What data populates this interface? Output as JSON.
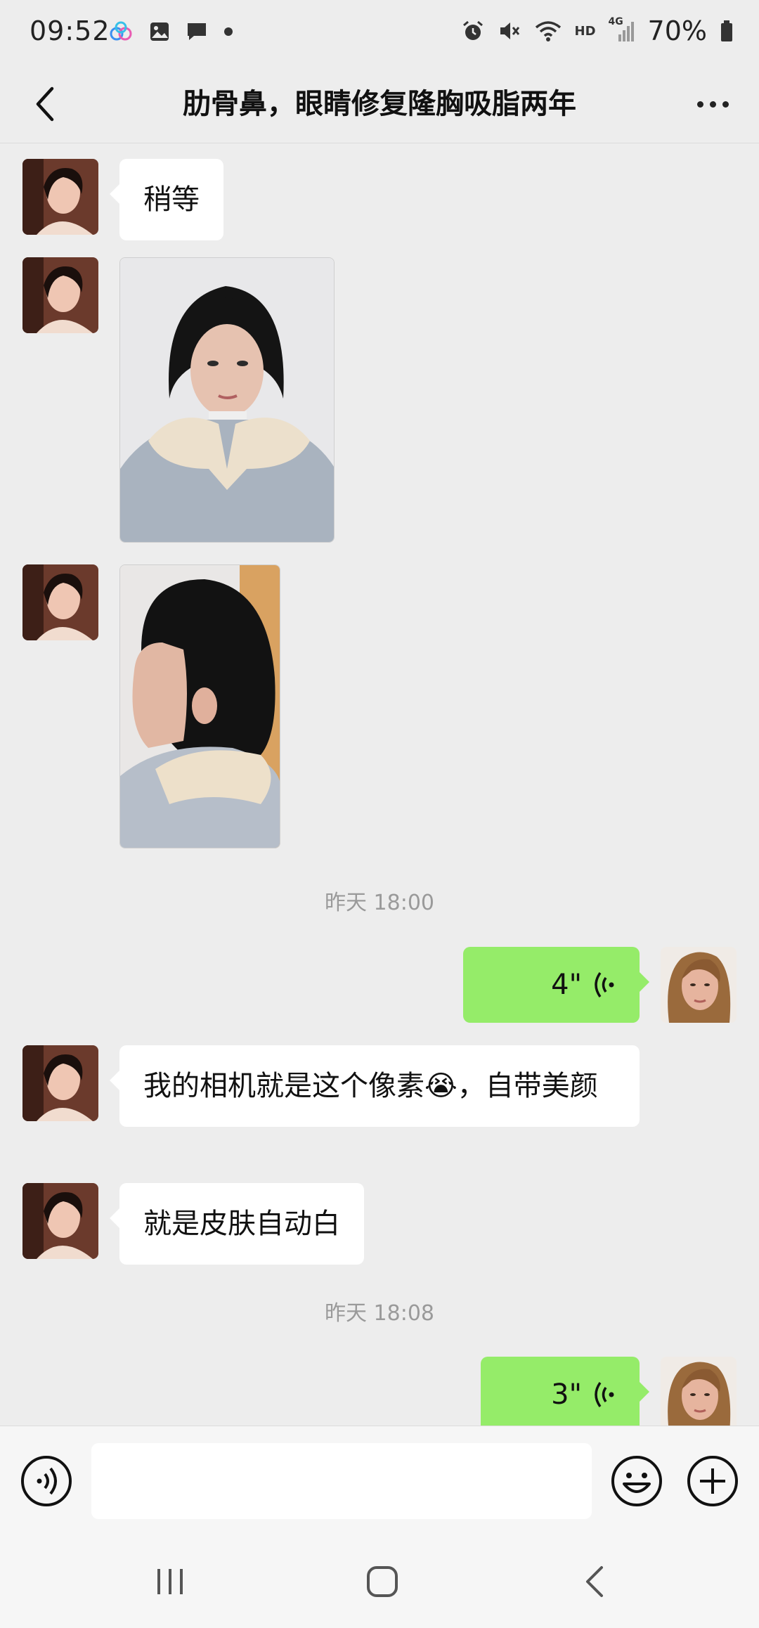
{
  "status_bar": {
    "time": "09:52",
    "battery_text": "70%",
    "network_label_hd": "HD",
    "network_label_4g": "4G"
  },
  "header": {
    "title": "肋骨鼻，眼睛修复隆胸吸脂两年"
  },
  "messages": [
    {
      "kind": "text",
      "from": "other",
      "text": "稍等"
    },
    {
      "kind": "image",
      "from": "other",
      "description_icon": "photo-front-view"
    },
    {
      "kind": "image",
      "from": "other",
      "description_icon": "photo-side-view"
    },
    {
      "kind": "time",
      "text": "昨天 18:00"
    },
    {
      "kind": "voice",
      "from": "me",
      "duration": "4\""
    },
    {
      "kind": "text",
      "from": "other",
      "text": "我的相机就是这个像素😭，自带美颜"
    },
    {
      "kind": "text",
      "from": "other",
      "text": "就是皮肤自动白"
    },
    {
      "kind": "time",
      "text": "昨天 18:08"
    },
    {
      "kind": "voice",
      "from": "me",
      "duration": "3\""
    }
  ],
  "input": {
    "placeholder": ""
  },
  "colors": {
    "background": "#ededed",
    "outgoing_bubble": "#95ec69",
    "incoming_bubble": "#ffffff",
    "timestamp_text": "#9a9a9a"
  }
}
